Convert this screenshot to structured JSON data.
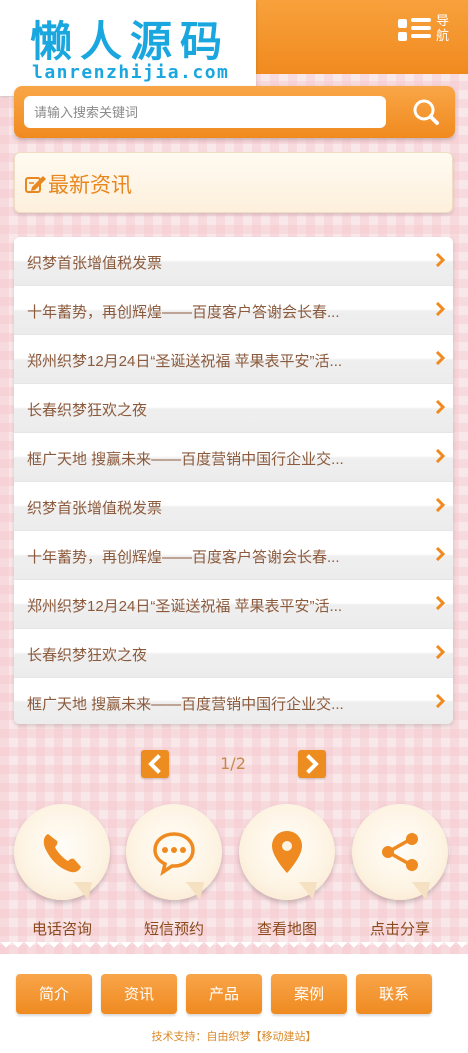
{
  "header": {
    "logo_cn": "懒人源码",
    "logo_en": "lanrenzhijia.com",
    "nav_label": "导航"
  },
  "search": {
    "placeholder": "请输入搜索关键词",
    "button_icon": "search-icon"
  },
  "section": {
    "title": "最新资讯",
    "icon": "edit-icon"
  },
  "news": [
    "织梦首张增值税发票",
    "十年蓄势，再创辉煌——百度客户答谢会长春...",
    "郑州织梦12月24日“圣诞送祝福 苹果表平安”活...",
    "长春织梦狂欢之夜",
    "框广天地 搜赢未来——百度营销中国行企业交...",
    "织梦首张增值税发票",
    "十年蓄势，再创辉煌——百度客户答谢会长春...",
    "郑州织梦12月24日“圣诞送祝福 苹果表平安”活...",
    "长春织梦狂欢之夜",
    "框广天地 搜赢未来——百度营销中国行企业交..."
  ],
  "pagination": {
    "current": "1/2"
  },
  "actions": [
    {
      "label": "电话咨询",
      "icon": "phone-icon"
    },
    {
      "label": "短信预约",
      "icon": "chat-icon"
    },
    {
      "label": "查看地图",
      "icon": "map-pin-icon"
    },
    {
      "label": "点击分享",
      "icon": "share-icon"
    }
  ],
  "footer": {
    "nav": [
      "简介",
      "资讯",
      "产品",
      "案例",
      "联系"
    ],
    "support": "技术支持：自由织梦【移动建站】"
  },
  "colors": {
    "accent": "#f08a1f",
    "logo": "#1aa7e0",
    "text": "#8b5a3c"
  }
}
